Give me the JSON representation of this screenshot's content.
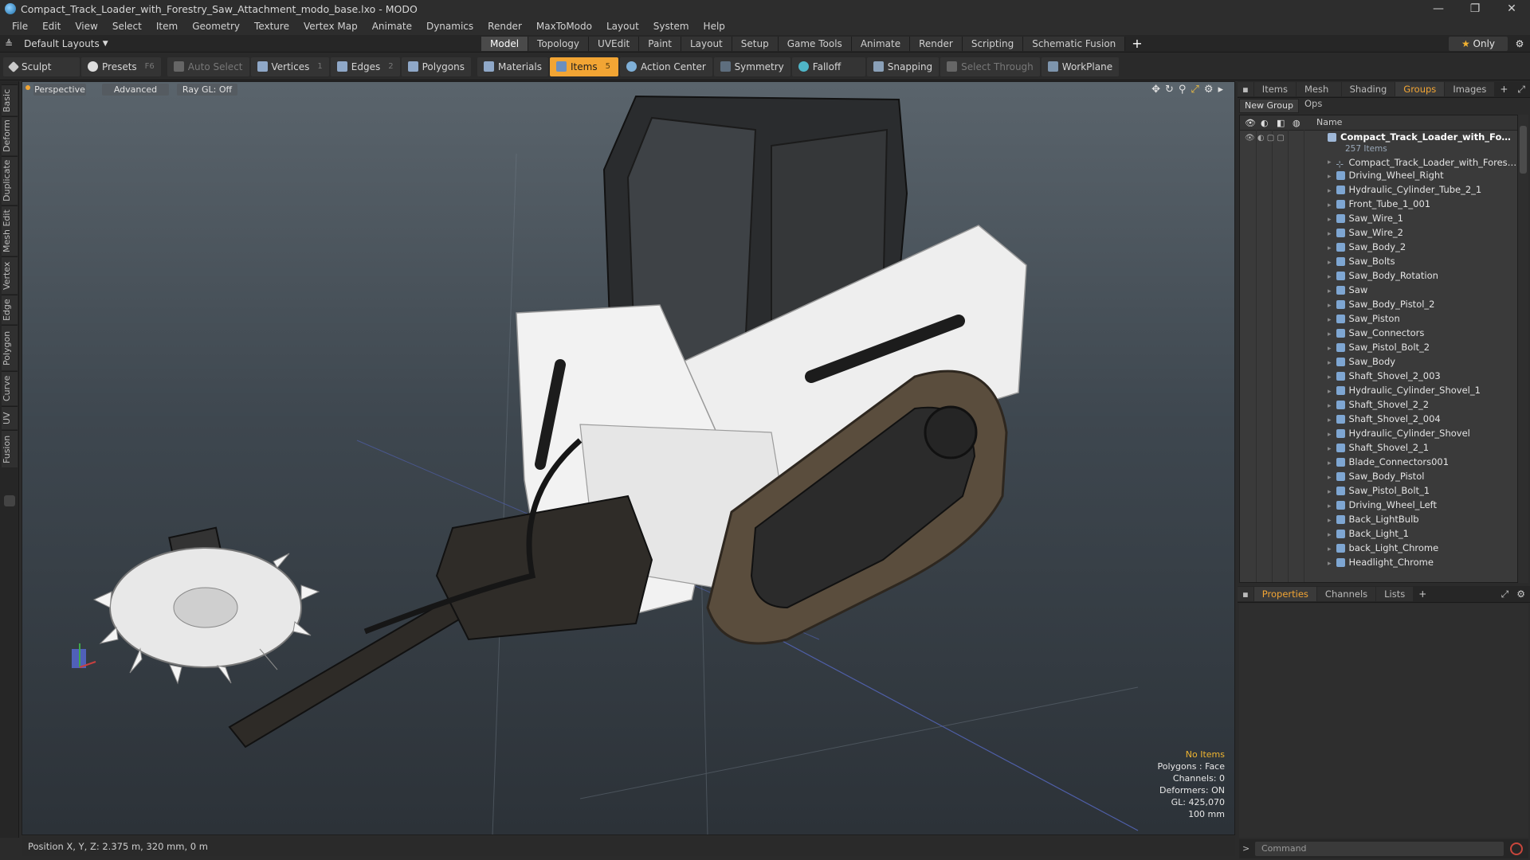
{
  "window": {
    "title": "Compact_Track_Loader_with_Forestry_Saw_Attachment_modo_base.lxo - MODO",
    "buttons": [
      "—",
      "❐",
      "✕"
    ]
  },
  "menu": [
    "File",
    "Edit",
    "View",
    "Select",
    "Item",
    "Geometry",
    "Texture",
    "Vertex Map",
    "Animate",
    "Dynamics",
    "Render",
    "MaxToModo",
    "Layout",
    "System",
    "Help"
  ],
  "layout_bar": {
    "layouts_label": "Default Layouts",
    "tabs": [
      "Model",
      "Topology",
      "UVEdit",
      "Paint",
      "Layout",
      "Setup",
      "Game Tools",
      "Animate",
      "Render",
      "Scripting",
      "Schematic Fusion"
    ],
    "active_tab": "Model",
    "only_label": "Only"
  },
  "toolbar": {
    "sculpt": "Sculpt",
    "presets": "Presets",
    "presets_key": "F6",
    "auto_select": "Auto Select",
    "vertices": "Vertices",
    "vertices_key": "1",
    "edges": "Edges",
    "edges_key": "2",
    "polygons": "Polygons",
    "materials": "Materials",
    "items": "Items",
    "items_key": "5",
    "action_center": "Action Center",
    "symmetry": "Symmetry",
    "falloff": "Falloff",
    "snapping": "Snapping",
    "select_through": "Select Through",
    "workplane": "WorkPlane"
  },
  "left_tabs": [
    "Basic",
    "Deform",
    "Duplicate",
    "Mesh Edit",
    "Vertex",
    "Edge",
    "Polygon",
    "Curve",
    "UV",
    "Fusion"
  ],
  "viewport": {
    "view_mode": "Perspective",
    "shading": "Advanced",
    "raygl": "Ray GL: Off",
    "stats": {
      "no_items": "No Items",
      "polygons": "Polygons : Face",
      "channels": "Channels: 0",
      "deformers": "Deformers: ON",
      "gl": "GL: 425,070",
      "scale": "100 mm"
    }
  },
  "status": {
    "position": "Position X, Y, Z:  2.375 m, 320 mm, 0 m"
  },
  "right_panel": {
    "top_tabs": [
      "Items",
      "Mesh Ops",
      "Shading",
      "Groups",
      "Images"
    ],
    "active_top_tab": "Groups",
    "new_group": "New Group",
    "name_header": "Name",
    "root": {
      "name": "Compact_Track_Loader_with_Forestry_Saw_Attachment",
      "count": "257 Items"
    },
    "items": [
      "Compact_Track_Loader_with_Forestry_Saw_Attachment",
      "Driving_Wheel_Right",
      "Hydraulic_Cylinder_Tube_2_1",
      "Front_Tube_1_001",
      "Saw_Wire_1",
      "Saw_Wire_2",
      "Saw_Body_2",
      "Saw_Bolts",
      "Saw_Body_Rotation",
      "Saw",
      "Saw_Body_Pistol_2",
      "Saw_Piston",
      "Saw_Connectors",
      "Saw_Pistol_Bolt_2",
      "Saw_Body",
      "Shaft_Shovel_2_003",
      "Hydraulic_Cylinder_Shovel_1",
      "Shaft_Shovel_2_2",
      "Shaft_Shovel_2_004",
      "Hydraulic_Cylinder_Shovel",
      "Shaft_Shovel_2_1",
      "Blade_Connectors001",
      "Saw_Body_Pistol",
      "Saw_Pistol_Bolt_1",
      "Driving_Wheel_Left",
      "Back_LightBulb",
      "Back_Light_1",
      "back_Light_Chrome",
      "Headlight_Chrome"
    ],
    "bottom_tabs": [
      "Properties",
      "Channels",
      "Lists"
    ],
    "active_bottom_tab": "Properties",
    "command_placeholder": "Command"
  }
}
